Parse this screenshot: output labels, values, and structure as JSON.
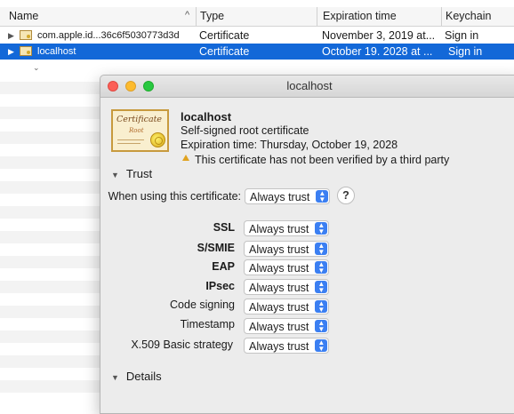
{
  "list": {
    "headers": {
      "name": "Name",
      "type": "Type",
      "expiration": "Expiration time",
      "keychain": "Keychain"
    },
    "rows": [
      {
        "name": "com.apple.id...36c6f5030773d3d",
        "type": "Certificate",
        "expiration": "November 3, 2019 at...",
        "keychain": "Sign in",
        "selected": false
      },
      {
        "name": "localhost",
        "type": "Certificate",
        "expiration": "October 19. 2028 at ...",
        "keychain": "Sign in",
        "selected": true
      }
    ]
  },
  "window": {
    "title": "localhost",
    "cert": {
      "icon_title": "Certificate",
      "icon_sub": "Root",
      "name": "localhost",
      "subtitle": "Self-signed root certificate",
      "expiration": "Expiration time: Thursday, October 19, 2028",
      "warning": "This certificate has not been verified by a third party"
    },
    "trust": {
      "section_label": "Trust",
      "when_using_label": "When using this certificate:",
      "when_using_value": "Always trust",
      "help": "?",
      "items": [
        {
          "label": "SSL",
          "value": "Always trust",
          "bold": true
        },
        {
          "label": "S/SMIE",
          "value": "Always trust",
          "bold": true
        },
        {
          "label": "EAP",
          "value": "Always trust",
          "bold": true
        },
        {
          "label": "IPsec",
          "value": "Always trust",
          "bold": true
        },
        {
          "label": "Code signing",
          "value": "Always trust",
          "bold": false
        },
        {
          "label": "Timestamp",
          "value": "Always trust",
          "bold": false
        },
        {
          "label": "X.509 Basic strategy",
          "value": "Always trust",
          "bold": false
        }
      ]
    },
    "details": {
      "section_label": "Details"
    }
  },
  "colors": {
    "selection": "#1368d8",
    "accent": "#3b7ff2"
  },
  "icons": [
    "sort-up-icon",
    "disclosure-triangle-icon",
    "certificate-icon",
    "warning-icon",
    "stepper-icon",
    "help-icon"
  ]
}
